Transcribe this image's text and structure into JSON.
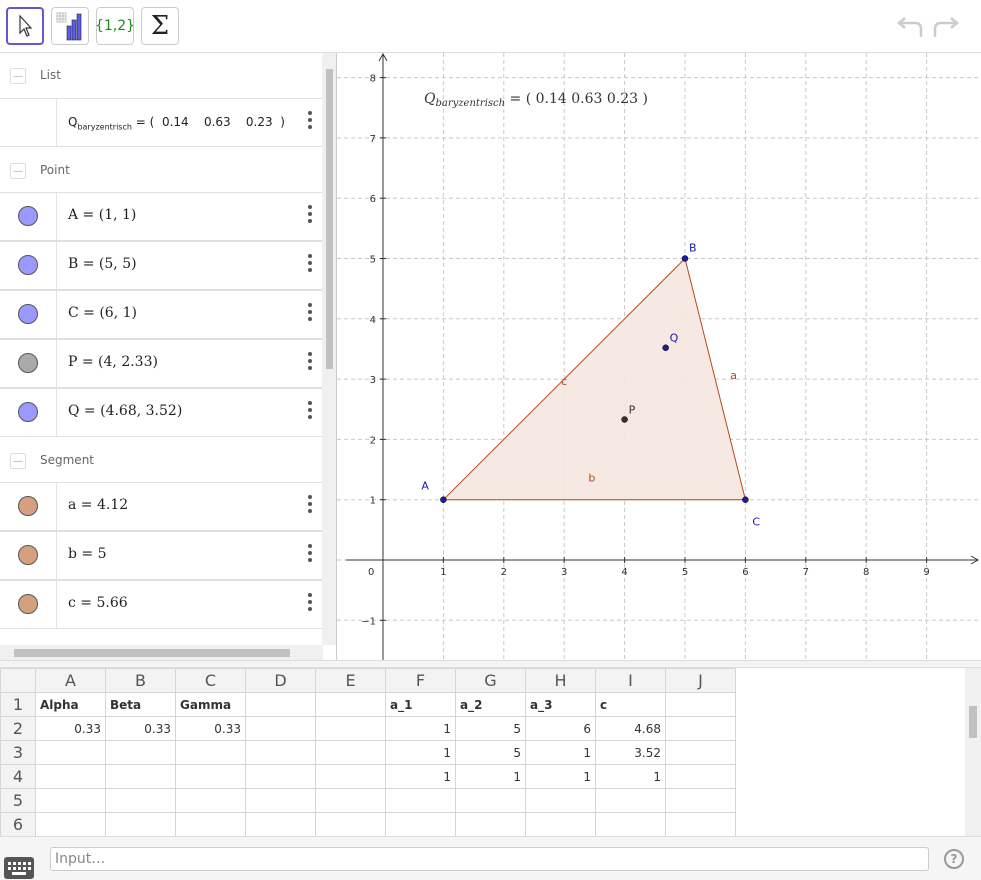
{
  "toolbar": {
    "set_label": "{1,2}"
  },
  "algebra": {
    "groups": {
      "list": "List",
      "point": "Point",
      "segment": "Segment"
    },
    "list_item": {
      "name": "Q",
      "sub": "baryzentrisch",
      "eq": "=",
      "values": "(  0.14    0.63    0.23  )"
    },
    "points": [
      {
        "expr": "A = (1, 1)",
        "color": "#9999ff"
      },
      {
        "expr": "B = (5, 5)",
        "color": "#9999ff"
      },
      {
        "expr": "C = (6, 1)",
        "color": "#9999ff"
      },
      {
        "expr": "P = (4, 2.33)",
        "color": "#aaaaaa"
      },
      {
        "expr": "Q = (4.68, 3.52)",
        "color": "#9999ff"
      }
    ],
    "segments": [
      {
        "expr": "a = 4.12",
        "color": "#d4a080"
      },
      {
        "expr": "b = 5",
        "color": "#d4a080"
      },
      {
        "expr": "c = 5.66",
        "color": "#d4a080"
      }
    ]
  },
  "graphics": {
    "x_ticks": [
      "1",
      "2",
      "3",
      "4",
      "5",
      "6",
      "7",
      "8",
      "9"
    ],
    "y_ticks": [
      "8",
      "7",
      "6",
      "5",
      "4",
      "3",
      "2",
      "1",
      "−1"
    ],
    "origin_label": "0",
    "caption": {
      "name": "Q",
      "sub": "baryzentrisch",
      "values": "= (  0.14    0.63    0.23  )"
    },
    "points": [
      {
        "label": "A",
        "x": 1,
        "y": 1,
        "color": "#1a1aa6"
      },
      {
        "label": "B",
        "x": 5,
        "y": 5,
        "color": "#1a1aa6"
      },
      {
        "label": "C",
        "x": 6,
        "y": 1,
        "color": "#1a1aa6"
      },
      {
        "label": "P",
        "x": 4,
        "y": 2.33,
        "color": "#333333"
      },
      {
        "label": "Q",
        "x": 4.68,
        "y": 3.52,
        "color": "#1a1aa6"
      }
    ],
    "segment_labels": [
      "a",
      "b",
      "c"
    ],
    "colors": {
      "triangle_fill": "#f5e6df",
      "triangle_stroke": "#b34a1a",
      "point_blue": "#1a1aa6"
    }
  },
  "spreadsheet": {
    "columns": [
      "A",
      "B",
      "C",
      "D",
      "E",
      "F",
      "G",
      "H",
      "I",
      "J"
    ],
    "rows": [
      [
        "Alpha",
        "Beta",
        "Gamma",
        "",
        "",
        "a_1",
        "a_2",
        "a_3",
        "c",
        ""
      ],
      [
        "0.33",
        "0.33",
        "0.33",
        "",
        "",
        "1",
        "5",
        "6",
        "4.68",
        ""
      ],
      [
        "",
        "",
        "",
        "",
        "",
        "1",
        "5",
        "1",
        "3.52",
        ""
      ],
      [
        "",
        "",
        "",
        "",
        "",
        "1",
        "1",
        "1",
        "1",
        ""
      ],
      [
        "",
        "",
        "",
        "",
        "",
        "",
        "",
        "",
        "",
        ""
      ],
      [
        "",
        "",
        "",
        "",
        "",
        "",
        "",
        "",
        "",
        ""
      ]
    ],
    "row_numbers": [
      "1",
      "2",
      "3",
      "4",
      "5",
      "6"
    ]
  },
  "input": {
    "placeholder": "Input…"
  },
  "help": {
    "label": "?"
  }
}
